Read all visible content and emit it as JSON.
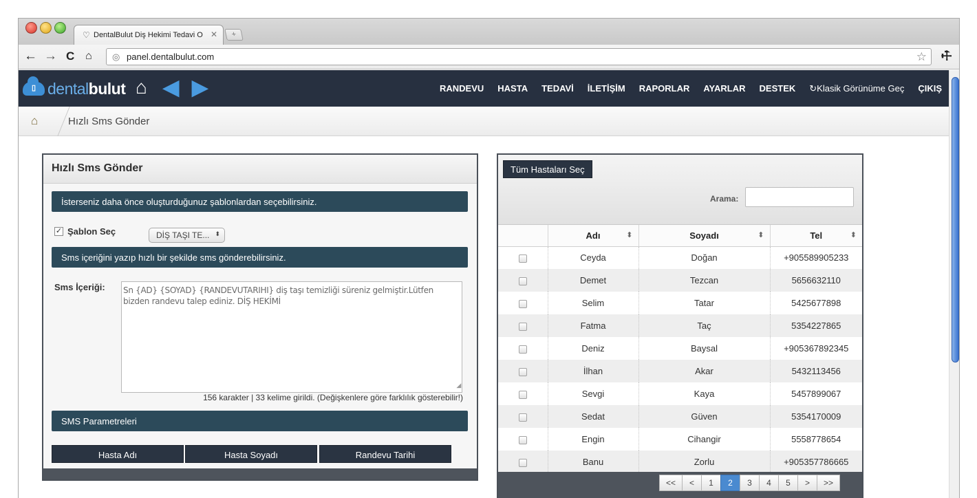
{
  "browser": {
    "tab_title": "DentalBulut Diş Hekimi Tedavi O",
    "tab_title_fade": "...",
    "tab_close": "✕",
    "new_tab": "+",
    "url": "panel.dentalbulut.com",
    "back": "←",
    "forward": "→",
    "reload": "C",
    "home": "🏠",
    "star": "☆",
    "wrench": "🔧"
  },
  "header": {
    "logo_part1": "dental",
    "logo_part2": "bulut",
    "home_icon": "🏠",
    "back_arrow": "◀",
    "forward_arrow": "▶",
    "menu": [
      "RANDEVU",
      "HASTA",
      "TEDAVİ",
      "İLETİŞİM",
      "RAPORLAR",
      "AYARLAR",
      "DESTEK"
    ],
    "classic_view": "↻Klasik Görünüme Geç",
    "logout": "ÇIKIŞ"
  },
  "breadcrumb": {
    "home_icon": "🏠",
    "page": "Hızlı Sms Gönder"
  },
  "sms_panel": {
    "title": "Hızlı Sms Gönder",
    "template_hint": "İsterseniz daha önce oluşturduğunuz şablonlardan seçebilirsiniz.",
    "template_checkbox_label": "Şablon Seç",
    "template_checked": "✓",
    "template_select_value": "DİŞ TAŞI TE...",
    "template_select_arrow": "⬍",
    "content_hint": "Sms içeriğini yazıp hızlı bir şekilde sms gönderebilirsiniz.",
    "content_label": "Sms İçeriği:",
    "content_text": "Sn {AD} {SOYAD} {RANDEVUTARIHI} diş taşı temizliği süreniz gelmiştir.Lütfen bizden randevu talep ediniz. DİŞ HEKİMİ",
    "counter": "156 karakter | 33 kelime girildi. (Değişkenlere göre farklılık gösterebilir!)",
    "params_title": "SMS Parametreleri",
    "param_buttons": [
      "Hasta Adı",
      "Hasta Soyadı",
      "Randevu Tarihi"
    ]
  },
  "patients_panel": {
    "select_all": "Tüm Hastaları Seç",
    "search_label": "Arama:",
    "search_value": "",
    "columns": [
      "",
      "Adı",
      "Soyadı",
      "Tel"
    ],
    "sort_icon": "⬍",
    "rows": [
      {
        "first": "Ceyda",
        "last": "Doğan",
        "tel": "+905589905233"
      },
      {
        "first": "Demet",
        "last": "Tezcan",
        "tel": "5656632110"
      },
      {
        "first": "Selim",
        "last": "Tatar",
        "tel": "5425677898"
      },
      {
        "first": "Fatma",
        "last": "Taç",
        "tel": "5354227865"
      },
      {
        "first": "Deniz",
        "last": "Baysal",
        "tel": "+905367892345"
      },
      {
        "first": "İlhan",
        "last": "Akar",
        "tel": "5432113456"
      },
      {
        "first": "Sevgi",
        "last": "Kaya",
        "tel": "5457899067"
      },
      {
        "first": "Sedat",
        "last": "Güven",
        "tel": "5354170009"
      },
      {
        "first": "Engin",
        "last": "Cihangir",
        "tel": "5558778654"
      },
      {
        "first": "Banu",
        "last": "Zorlu",
        "tel": "+905357786665"
      }
    ],
    "pager": {
      "first": "<<",
      "prev": "<",
      "pages": [
        "1",
        "2",
        "3",
        "4",
        "5"
      ],
      "current_page": "2",
      "next": ">",
      "last": ">>"
    }
  },
  "colors": {
    "header_bg": "#273040",
    "bar_bg": "#2c4a5a",
    "button_bg": "#2a3442",
    "accent": "#4a8ad0"
  }
}
